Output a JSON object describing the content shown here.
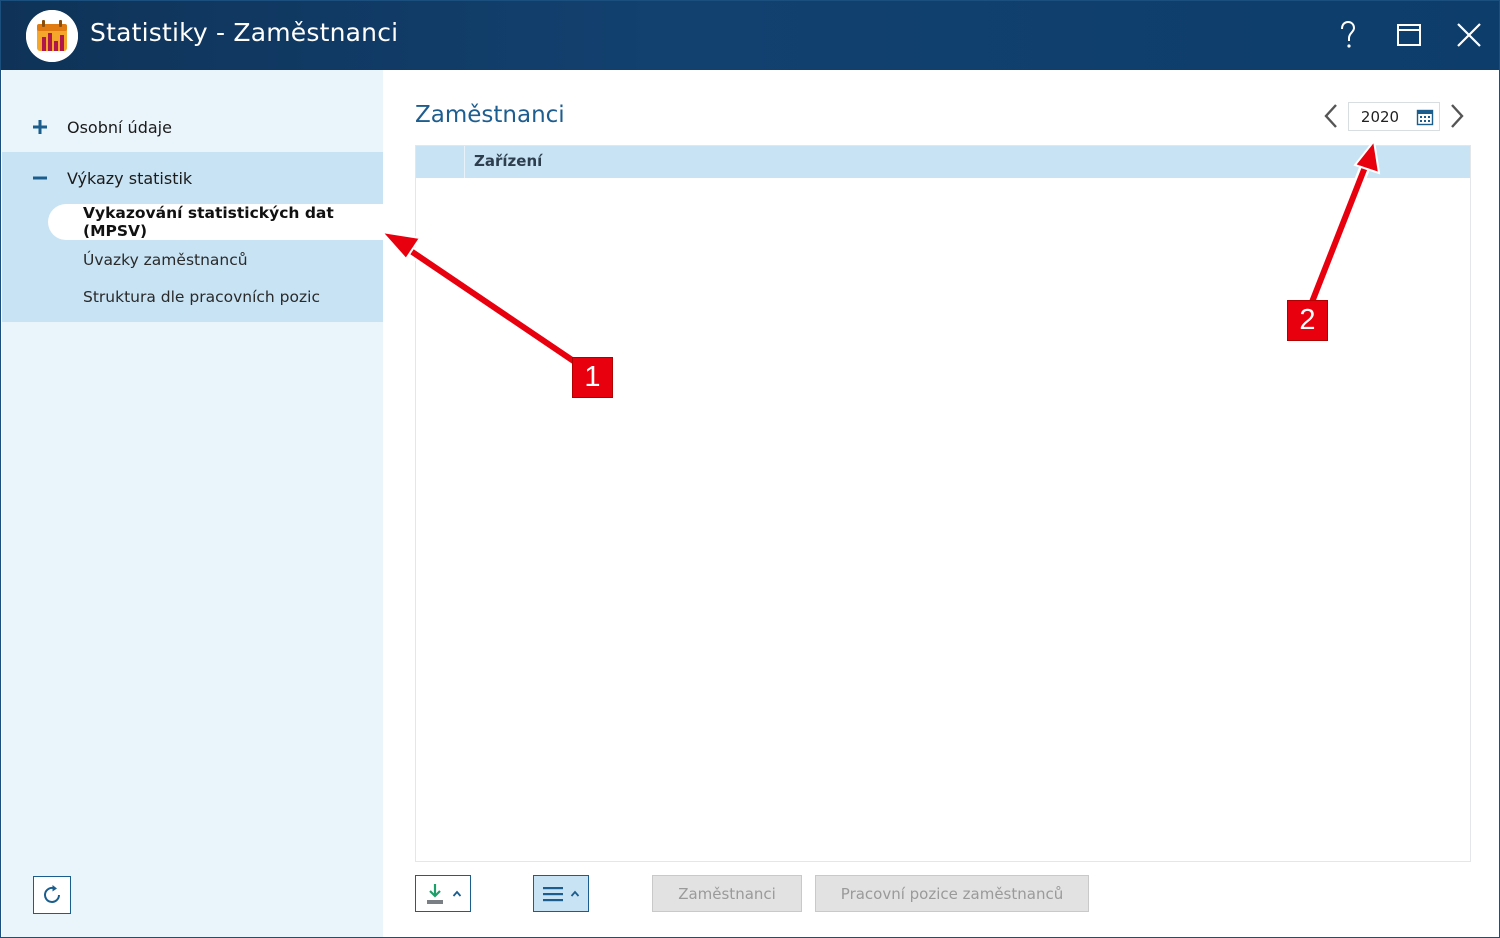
{
  "window": {
    "title": "Statistiky - Zaměstnanci",
    "controls": [
      "help-icon",
      "maximize-icon",
      "close-icon"
    ]
  },
  "sidebar": {
    "sections": [
      {
        "symbol": "+",
        "label": "Osobní údaje",
        "expanded": false
      },
      {
        "symbol": "−",
        "label": "Výkazy statistik",
        "expanded": true
      }
    ],
    "items": [
      {
        "label": "Vykazování statistických dat (MPSV)",
        "active": true
      },
      {
        "label": "Úvazky zaměstnanců",
        "active": false
      },
      {
        "label": "Struktura dle pracovních pozic",
        "active": false
      }
    ],
    "refresh_icon": "refresh-icon"
  },
  "main": {
    "title": "Zaměstnanci",
    "year": "2020",
    "grid": {
      "columns": [
        "Zařízení"
      ],
      "rows": []
    }
  },
  "toolbar": {
    "export_icon": "download-icon",
    "menu_icon": "hamburger-menu-icon",
    "buttons": [
      {
        "label": "Zaměstnanci",
        "enabled": false
      },
      {
        "label": "Pracovní pozice zaměstnanců",
        "enabled": false
      }
    ]
  },
  "annotations": [
    {
      "number": "1"
    },
    {
      "number": "2"
    }
  ],
  "colors": {
    "titlebar": "#124170",
    "sidebar_bg": "#eaf4fb",
    "sidebar_selected": "#c8e3f4",
    "accent_text": "#1d5d8f",
    "annotation_red": "#e8000f"
  }
}
